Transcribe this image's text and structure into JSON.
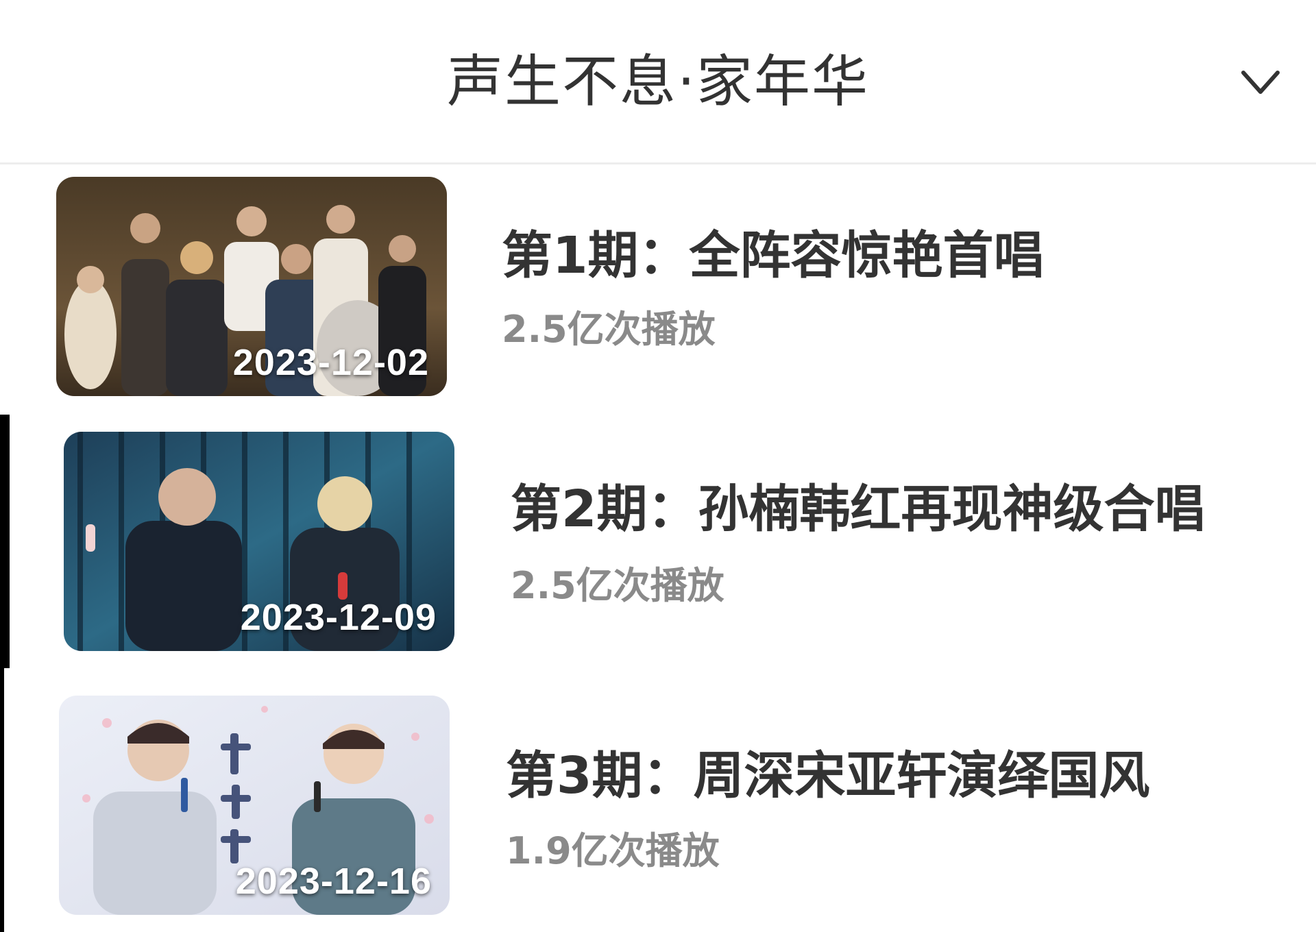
{
  "header": {
    "title": "声生不息·家年华",
    "expand_icon": "chevron-down-icon"
  },
  "episodes": [
    {
      "title": "第1期：全阵容惊艳首唱",
      "plays": "2.5亿次播放",
      "date": "2023-12-02"
    },
    {
      "title": "第2期：孙楠韩红再现神级合唱",
      "plays": "2.5亿次播放",
      "date": "2023-12-09"
    },
    {
      "title": "第3期：周深宋亚轩演绎国风",
      "plays": "1.9亿次播放",
      "date": "2023-12-16"
    }
  ],
  "colors": {
    "title_text": "#333333",
    "secondary_text": "#8a8a8a",
    "divider": "#ededed",
    "background": "#ffffff"
  }
}
